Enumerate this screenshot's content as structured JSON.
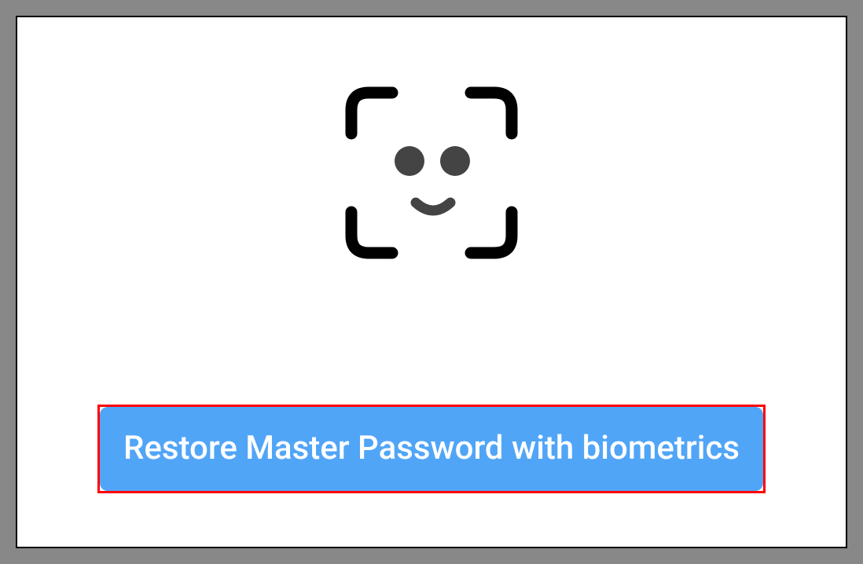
{
  "button": {
    "restore_label": "Restore Master Password with biometrics"
  },
  "icon": {
    "name": "face-id-icon"
  }
}
